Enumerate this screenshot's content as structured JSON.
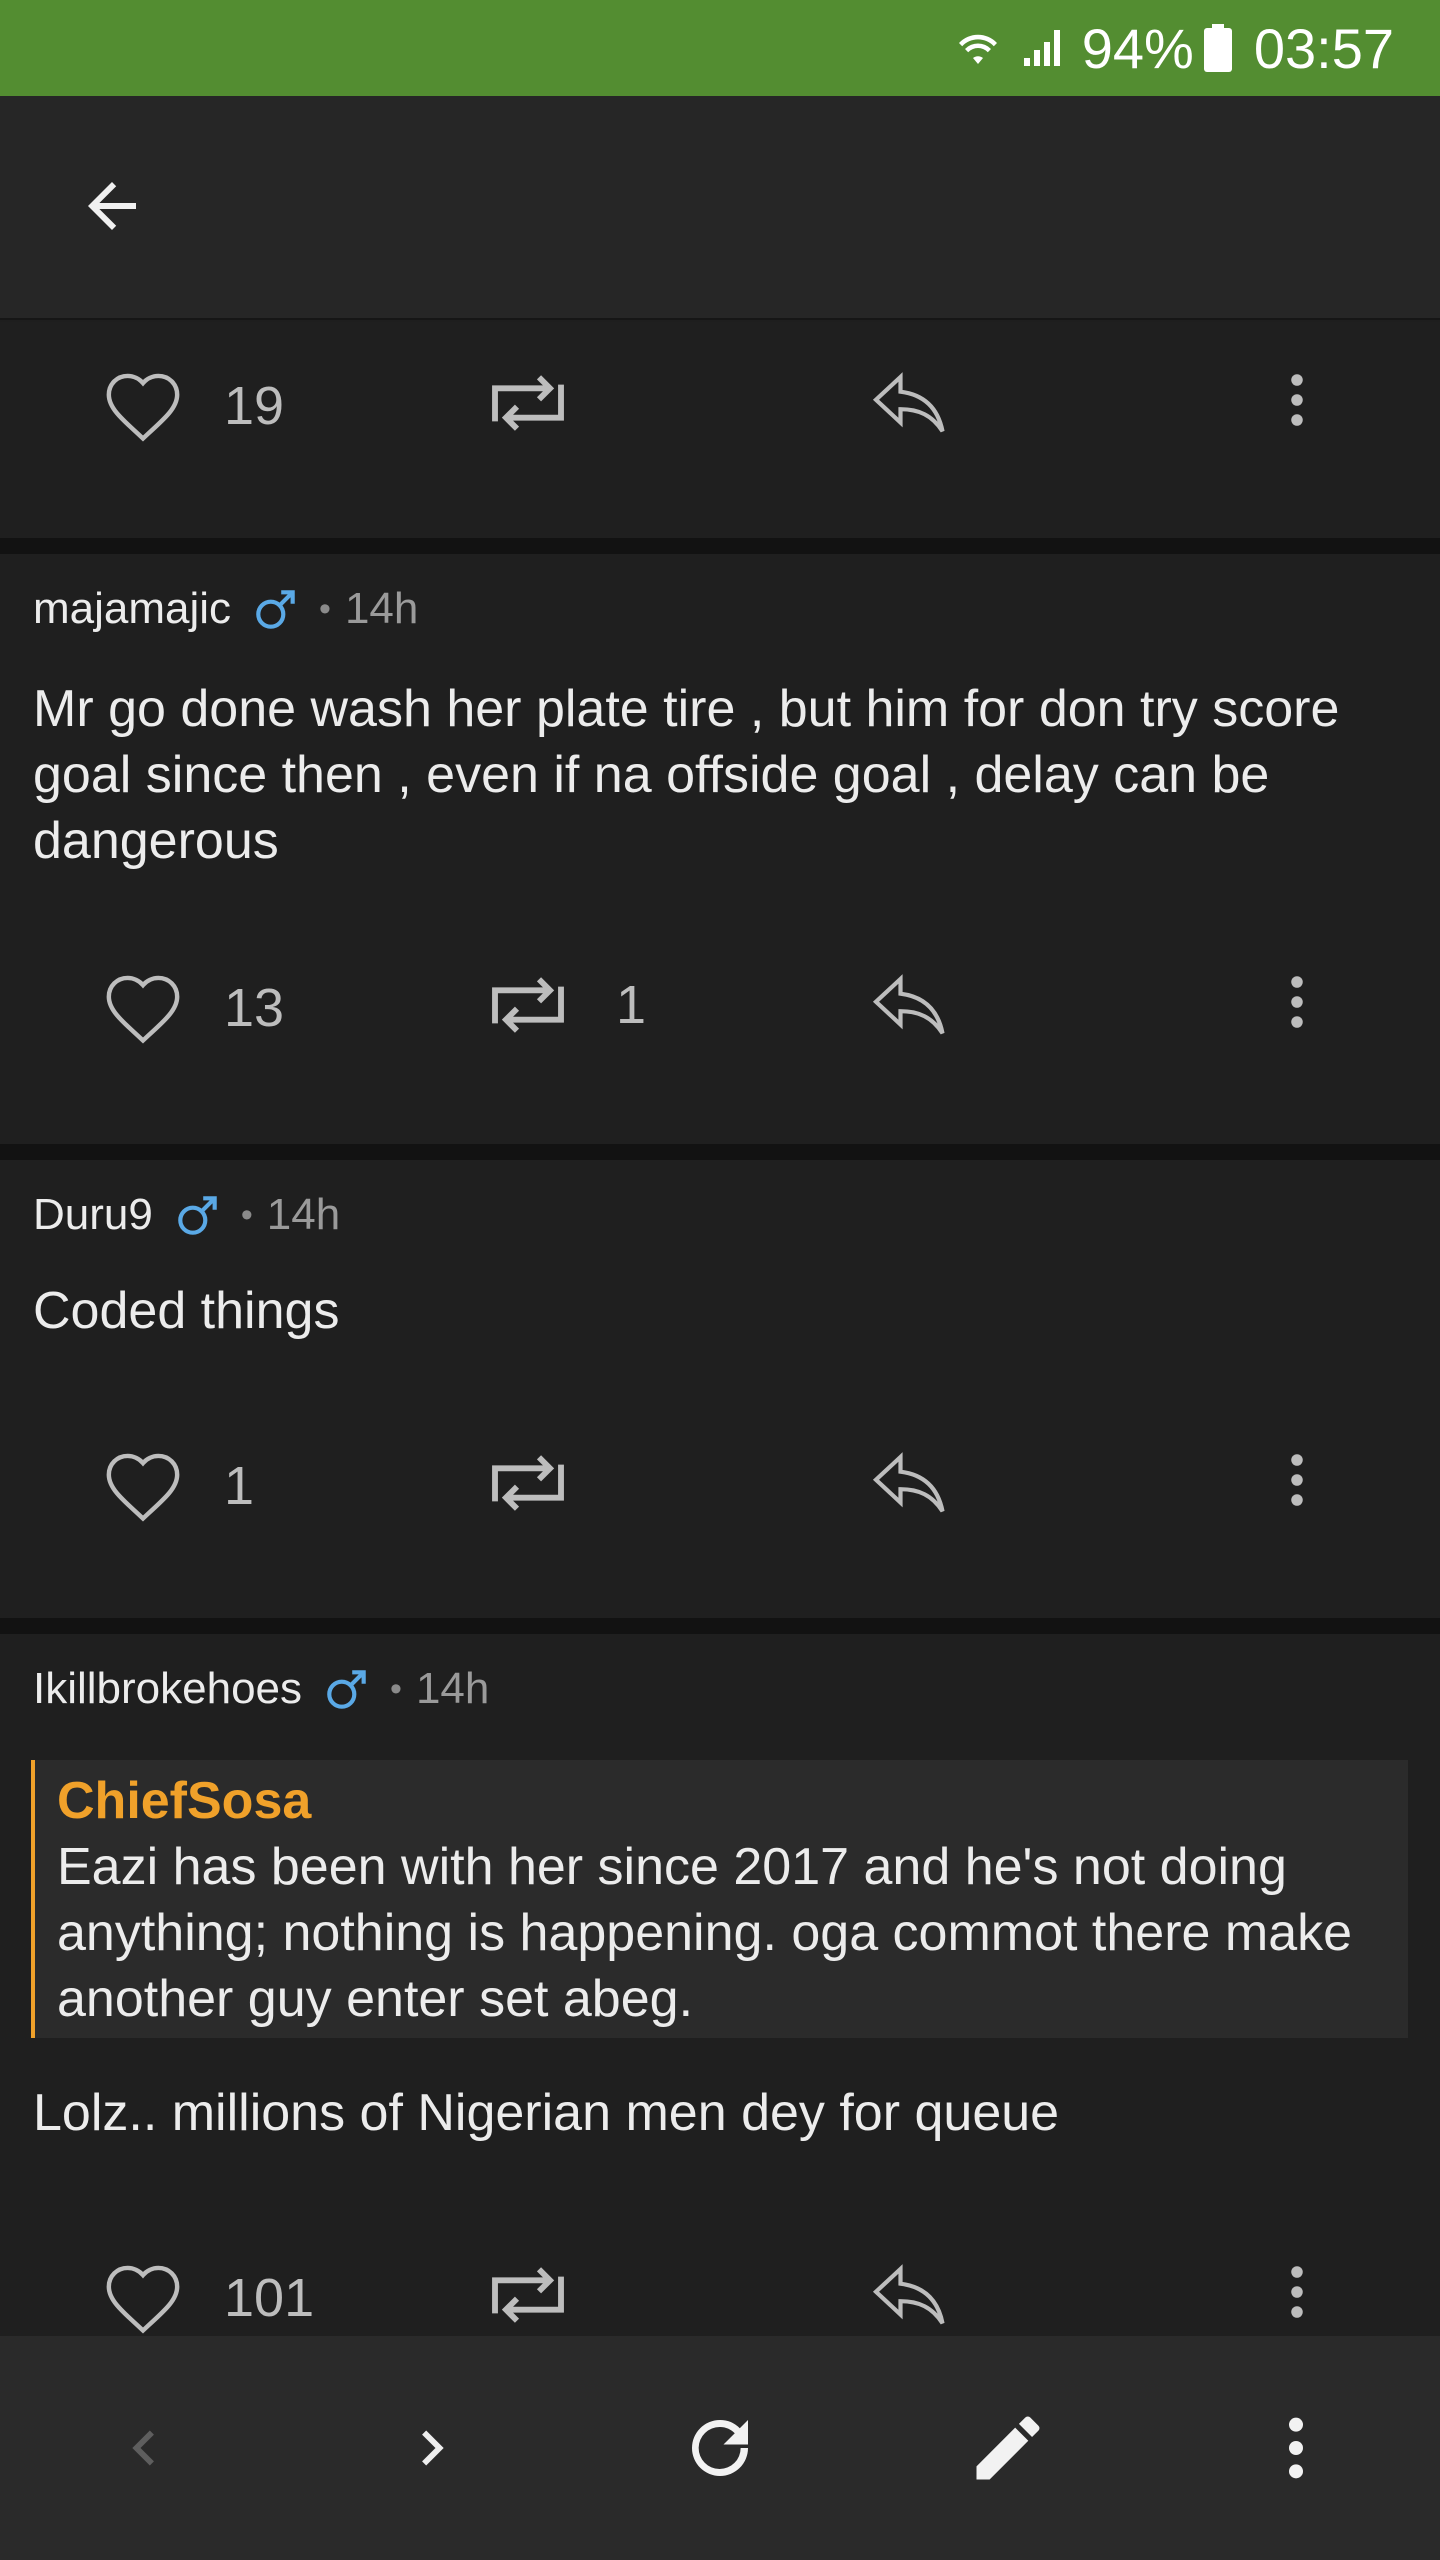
{
  "status_bar": {
    "battery": "94%",
    "time": "03:57"
  },
  "posts": [
    {
      "likes": "19",
      "reposts": ""
    },
    {
      "username": "majamajic",
      "time": "14h",
      "text": "Mr go done wash her plate tire , but him for don try score goal since then , even if na offside goal , delay can be dangerous",
      "likes": "13",
      "reposts": "1"
    },
    {
      "username": "Duru9",
      "time": "14h",
      "text": "Coded things",
      "likes": "1",
      "reposts": ""
    },
    {
      "username": "Ikillbrokehoes",
      "time": "14h",
      "quote": {
        "author": "ChiefSosa",
        "text": "Eazi has been with her since 2017 and he's not doing anything; nothing is happening. oga commot there make another guy enter set abeg."
      },
      "text": "Lolz.. millions of Nigerian men dey for queue",
      "likes": "101",
      "reposts": ""
    }
  ],
  "colors": {
    "status_bar": "#538d31",
    "quote_accent": "#f0a12a",
    "gender_icon": "#5aa9e6"
  }
}
